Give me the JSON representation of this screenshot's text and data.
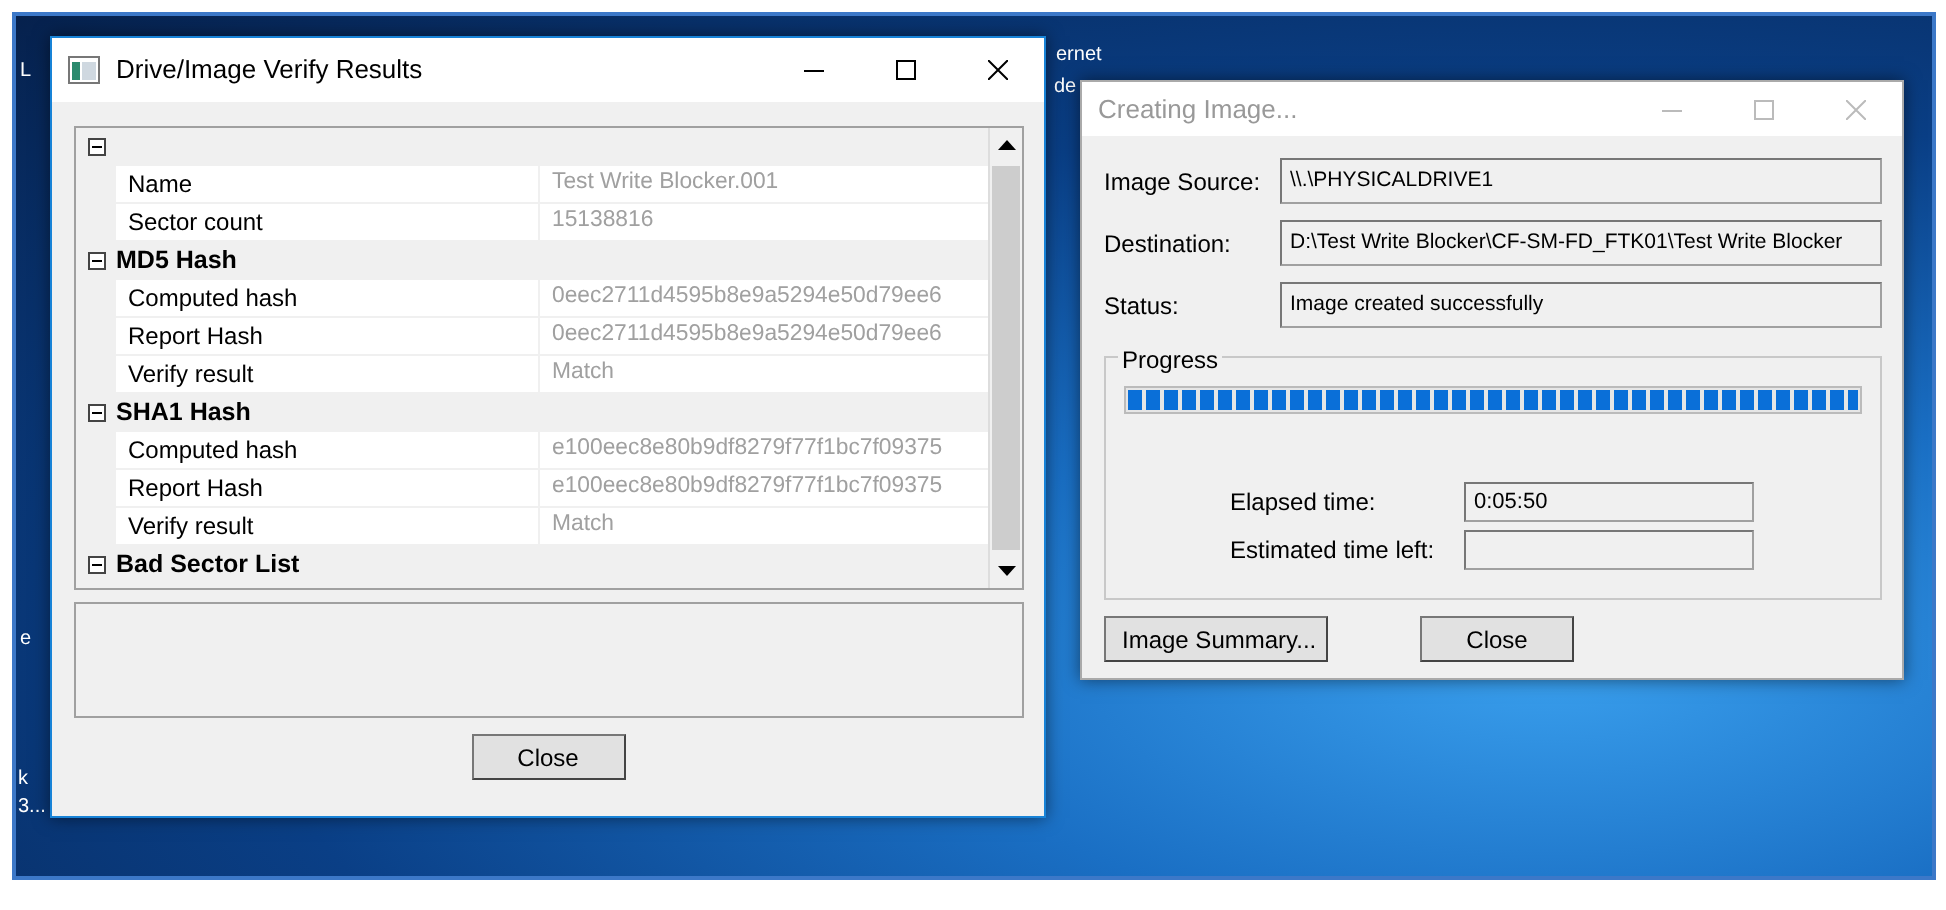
{
  "desktop_labels": [
    {
      "text": "L"
    },
    {
      "text": "ernet"
    },
    {
      "text": "de"
    },
    {
      "text": "e"
    },
    {
      "text": "k"
    },
    {
      "text": "3..."
    }
  ],
  "verify_window": {
    "title": "Drive/Image Verify Results",
    "active": true,
    "groups": [
      {
        "expanded": true,
        "rows": [
          {
            "name": "Name",
            "value": "Test Write Blocker.001"
          },
          {
            "name": "Sector count",
            "value": "15138816"
          }
        ]
      },
      {
        "title": "MD5 Hash",
        "expanded": true,
        "rows": [
          {
            "name": "Computed hash",
            "value": "0eec2711d4595b8e9a5294e50d79ee6"
          },
          {
            "name": "Report Hash",
            "value": "0eec2711d4595b8e9a5294e50d79ee6"
          },
          {
            "name": "Verify result",
            "value": "Match"
          }
        ]
      },
      {
        "title": "SHA1 Hash",
        "expanded": true,
        "rows": [
          {
            "name": "Computed hash",
            "value": "e100eec8e80b9df8279f77f1bc7f09375"
          },
          {
            "name": "Report Hash",
            "value": "e100eec8e80b9df8279f77f1bc7f09375"
          },
          {
            "name": "Verify result",
            "value": "Match"
          }
        ]
      },
      {
        "title": "Bad Sector List",
        "expanded": true
      }
    ],
    "close_button": "Close"
  },
  "image_window": {
    "title": "Creating Image...",
    "active": false,
    "fields": [
      {
        "label": "Image Source:",
        "value": "\\\\.\\PHYSICALDRIVE1"
      },
      {
        "label": "Destination:",
        "value": "D:\\Test Write Blocker\\CF-SM-FD_FTK01\\Test Write Blocker"
      },
      {
        "label": "Status:",
        "value": "Image created successfully"
      }
    ],
    "progress": {
      "title": "Progress",
      "level": 1.0,
      "times": [
        {
          "label": "Elapsed time:",
          "value": "0:05:50"
        },
        {
          "label": "Estimated time left:"
        }
      ]
    },
    "buttons": [
      "Image Summary...",
      "Close"
    ]
  }
}
